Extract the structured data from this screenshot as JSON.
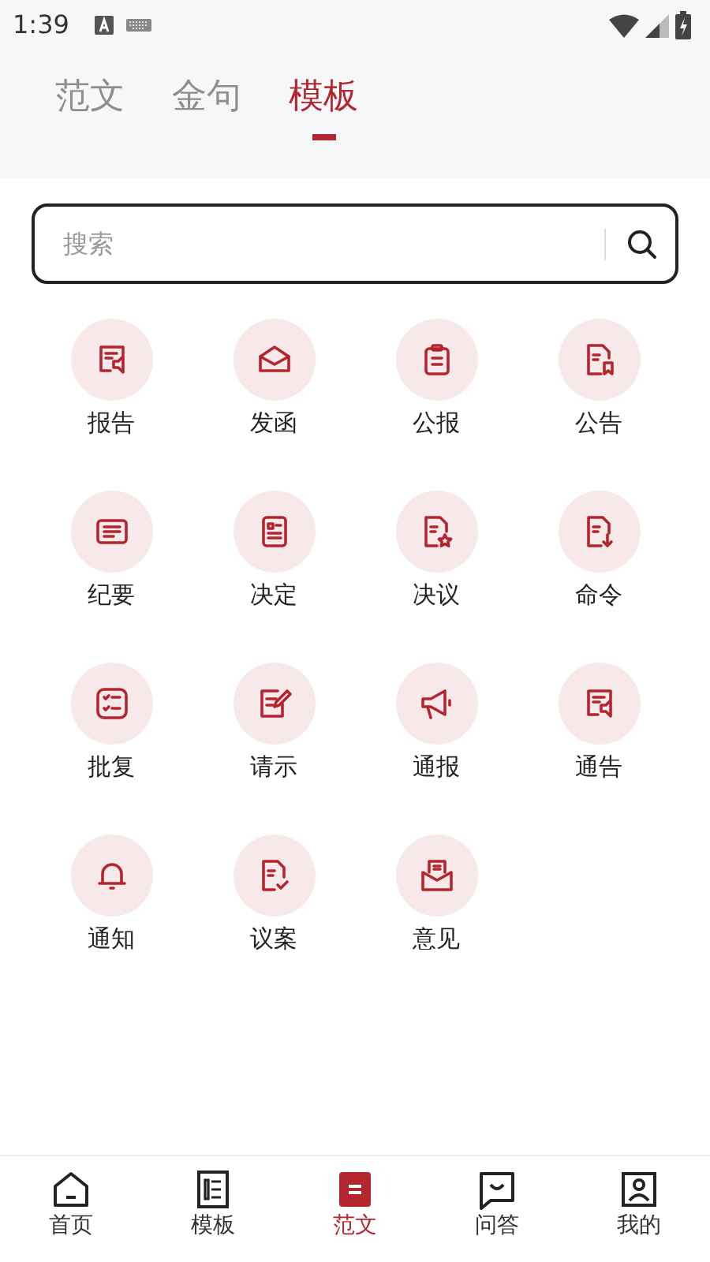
{
  "status_bar": {
    "time": "1:39"
  },
  "tabs": [
    {
      "label": "范文",
      "selected": false
    },
    {
      "label": "金句",
      "selected": false
    },
    {
      "label": "模板",
      "selected": true
    }
  ],
  "search": {
    "placeholder": "搜索"
  },
  "categories": [
    {
      "label": "报告"
    },
    {
      "label": "发函"
    },
    {
      "label": "公报"
    },
    {
      "label": "公告"
    },
    {
      "label": "纪要"
    },
    {
      "label": "决定"
    },
    {
      "label": "决议"
    },
    {
      "label": "命令"
    },
    {
      "label": "批复"
    },
    {
      "label": "请示"
    },
    {
      "label": "通报"
    },
    {
      "label": "通告"
    },
    {
      "label": "通知"
    },
    {
      "label": "议案"
    },
    {
      "label": "意见"
    }
  ],
  "bottom_nav": [
    {
      "label": "首页",
      "selected": false
    },
    {
      "label": "模板",
      "selected": false
    },
    {
      "label": "范文",
      "selected": true
    },
    {
      "label": "问答",
      "selected": false
    },
    {
      "label": "我的",
      "selected": false
    }
  ]
}
